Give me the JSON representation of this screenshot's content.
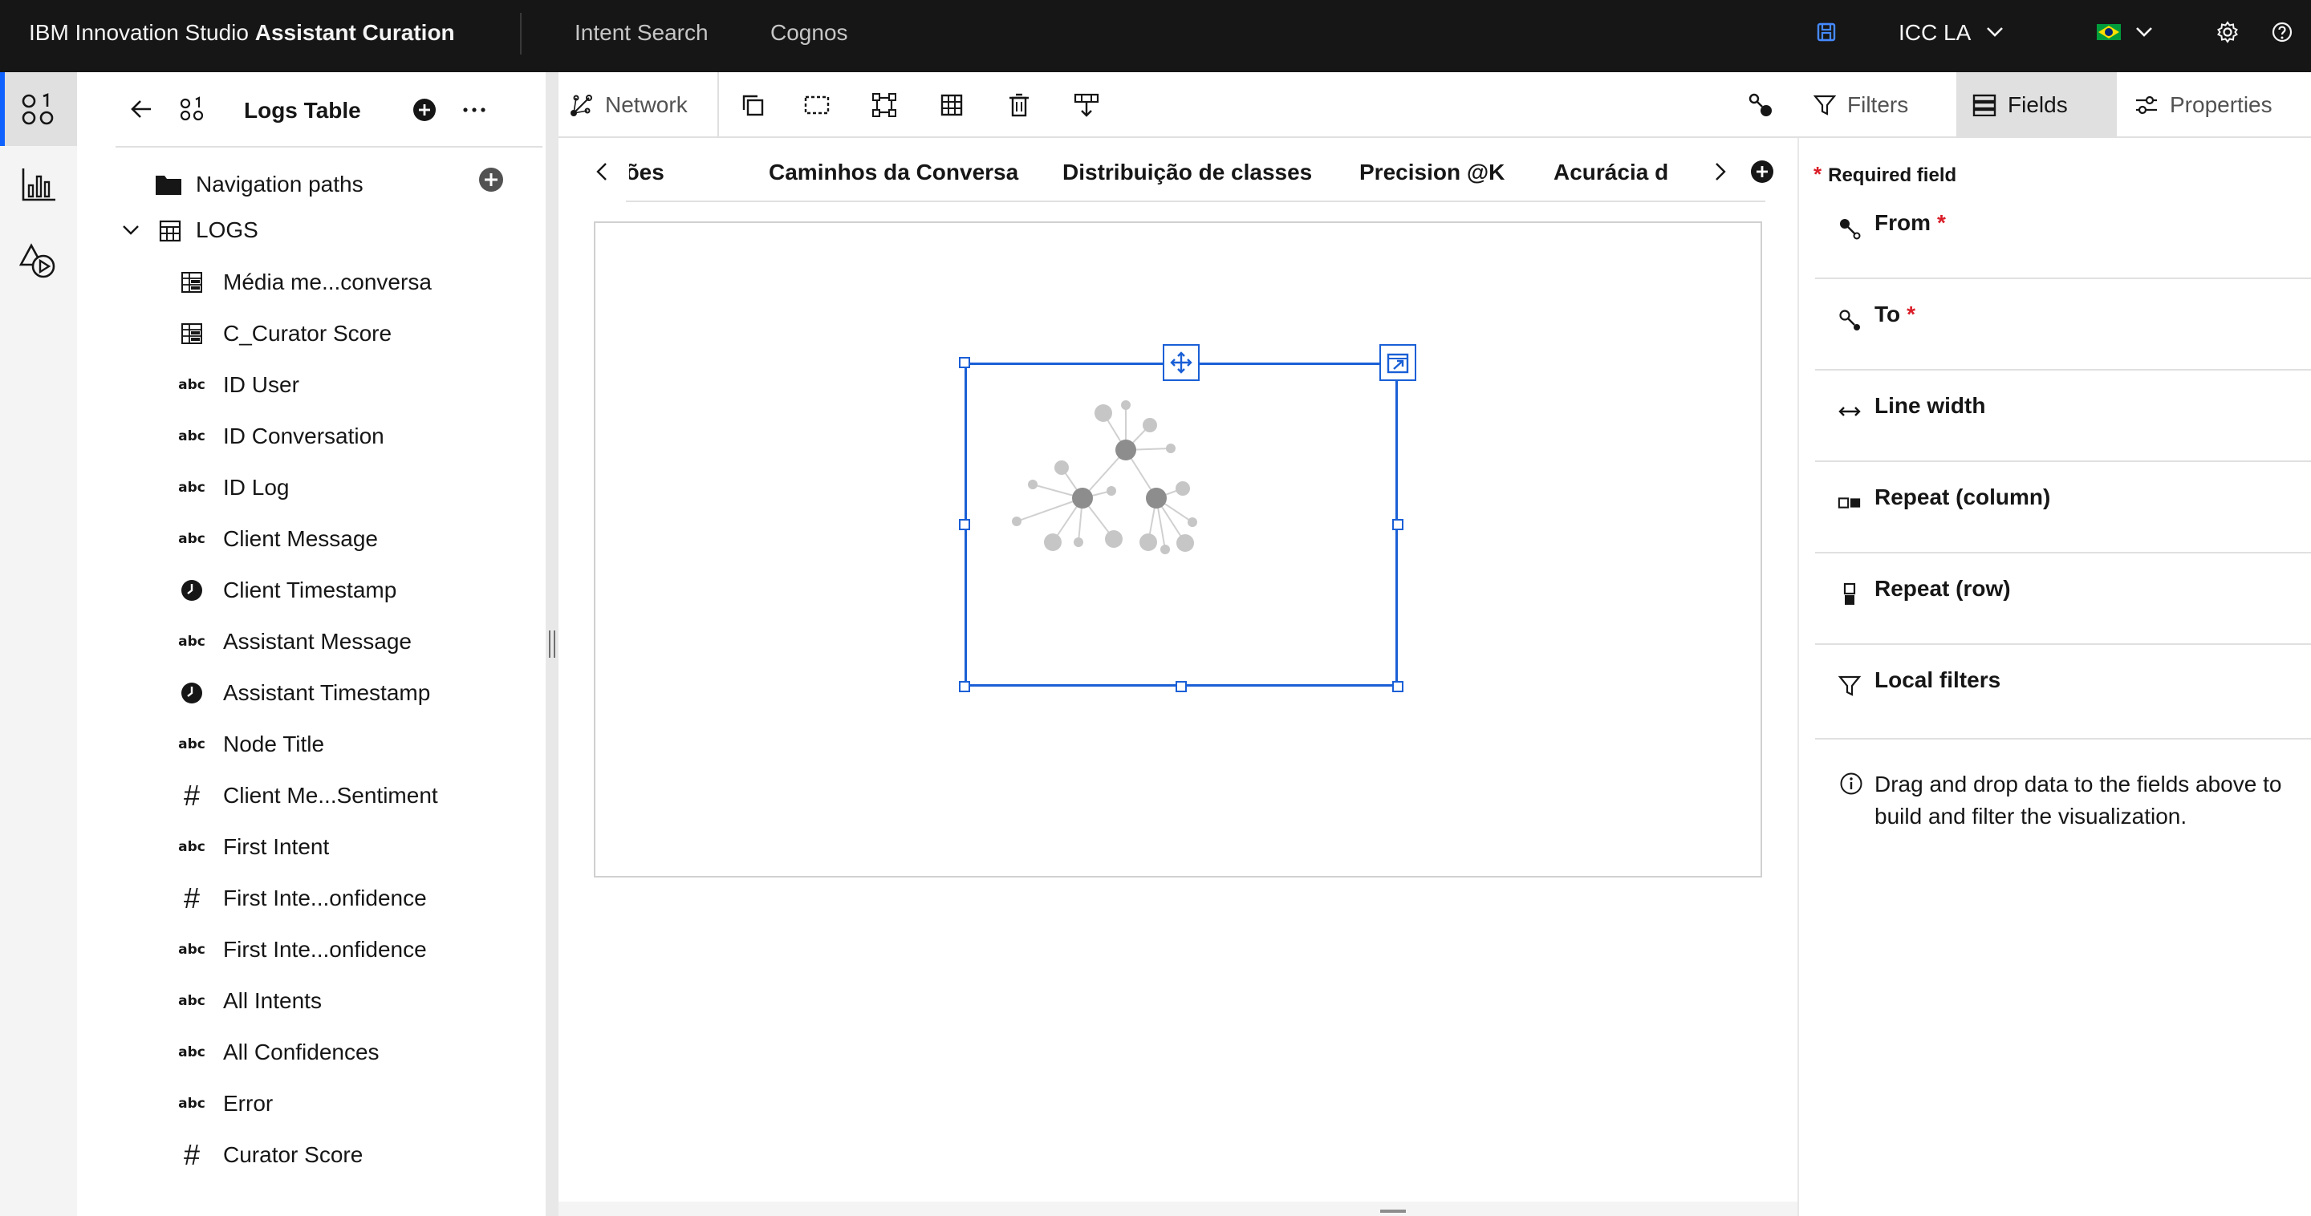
{
  "topbar": {
    "brand_regular": "IBM Innovation Studio ",
    "brand_bold": "Assistant Curation",
    "nav": [
      "Intent Search",
      "Cognos"
    ],
    "tenant": "ICC LA",
    "icons": [
      "save-icon",
      "chevron-down-icon",
      "brazil-flag-icon",
      "settings-icon",
      "help-icon"
    ]
  },
  "rail": {
    "items": [
      "data-icon",
      "chart-icon",
      "shapes-icon"
    ]
  },
  "left_panel": {
    "title": "Logs Table",
    "tree": {
      "folder": "Navigation paths",
      "table": "LOGS"
    },
    "fields": [
      {
        "type": "measure-table",
        "name": "Média me...conversa"
      },
      {
        "type": "measure-table",
        "name": "C_Curator Score"
      },
      {
        "type": "abc",
        "name": "ID User"
      },
      {
        "type": "abc",
        "name": "ID Conversation"
      },
      {
        "type": "abc",
        "name": "ID Log"
      },
      {
        "type": "abc",
        "name": "Client Message"
      },
      {
        "type": "clock",
        "name": "Client Timestamp"
      },
      {
        "type": "abc",
        "name": "Assistant Message"
      },
      {
        "type": "clock",
        "name": "Assistant Timestamp"
      },
      {
        "type": "abc",
        "name": "Node Title"
      },
      {
        "type": "hash",
        "name": "Client Me...Sentiment"
      },
      {
        "type": "abc",
        "name": "First Intent"
      },
      {
        "type": "hash",
        "name": "First Inte...onfidence"
      },
      {
        "type": "abc",
        "name": "First Inte...onfidence"
      },
      {
        "type": "abc",
        "name": "All Intents"
      },
      {
        "type": "abc",
        "name": "All Confidences"
      },
      {
        "type": "abc",
        "name": "Error"
      },
      {
        "type": "hash",
        "name": "Curator Score"
      }
    ],
    "type_labels": {
      "abc": "abc",
      "hash": "#"
    }
  },
  "toolbar": {
    "visualization_type": "Network"
  },
  "right_tabs": [
    {
      "label": "Filters",
      "active": false
    },
    {
      "label": "Fields",
      "active": true
    },
    {
      "label": "Properties",
      "active": false
    }
  ],
  "page_tabs": [
    "tenções",
    "Caminhos da Conversa",
    "Distribuição de classes",
    "Precision @K",
    "Acurácia d"
  ],
  "fields_panel": {
    "required_label": "Required field",
    "wells": [
      {
        "label": "From",
        "required": true,
        "icon": "from-node-icon"
      },
      {
        "label": "To",
        "required": true,
        "icon": "to-node-icon"
      },
      {
        "label": "Line width",
        "required": false,
        "icon": "line-width-icon"
      },
      {
        "label": "Repeat (column)",
        "required": false,
        "icon": "repeat-column-icon"
      },
      {
        "label": "Repeat (row)",
        "required": false,
        "icon": "repeat-row-icon"
      },
      {
        "label": "Local filters",
        "required": false,
        "icon": "filter-icon"
      }
    ],
    "star": "*",
    "hint": "Drag and drop data to the fields above to build and filter the visualization."
  },
  "colors": {
    "topbar_bg": "#161616",
    "accent": "#0f62fe",
    "selection": "#1a5fd6",
    "required": "#da1e28"
  }
}
